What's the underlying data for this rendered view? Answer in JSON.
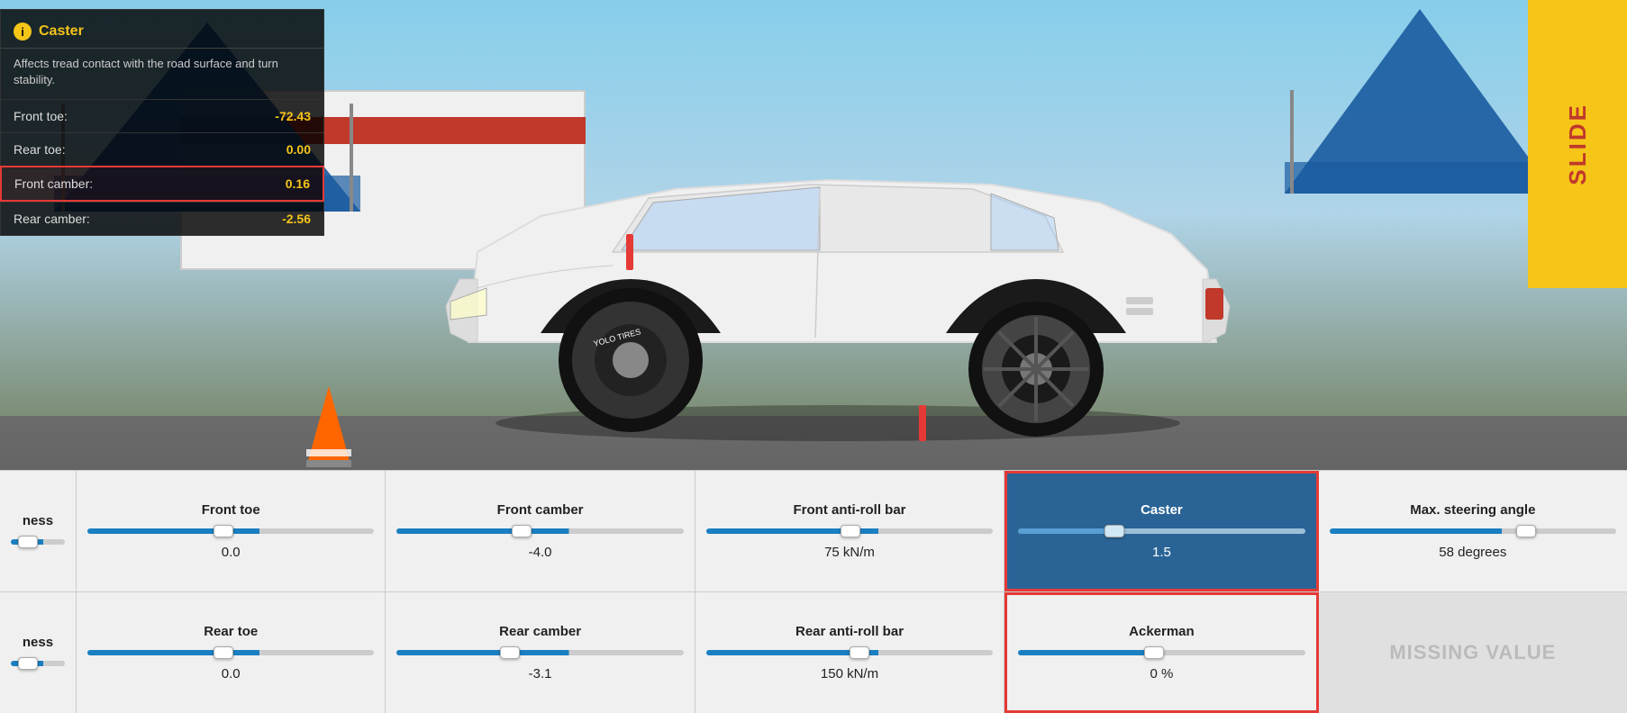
{
  "scene": {
    "bg_color_top": "#87CEEB",
    "bg_color_bottom": "#5a5a5a"
  },
  "info_panel": {
    "icon": "i",
    "title": "Caster",
    "description": "Affects tread contact with the road surface and turn stability.",
    "stats": [
      {
        "label": "Front toe:",
        "value": "-72.43",
        "highlighted": false
      },
      {
        "label": "Rear toe:",
        "value": "0.00",
        "highlighted": false
      },
      {
        "label": "Front camber:",
        "value": "0.16",
        "highlighted": true
      },
      {
        "label": "Rear camber:",
        "value": "-2.56",
        "highlighted": false
      }
    ]
  },
  "bottom_bar": {
    "row1": [
      {
        "id": "stiffness1",
        "label": "ness",
        "value": "",
        "has_slider": true,
        "slider_type": "normal",
        "thumb_pos": "20%",
        "partial": true,
        "active": false
      },
      {
        "id": "front-toe",
        "label": "Front toe",
        "value": "0.0",
        "has_slider": true,
        "slider_type": "normal",
        "thumb_pos": "50%",
        "active": false
      },
      {
        "id": "front-camber",
        "label": "Front camber",
        "value": "-4.0",
        "has_slider": true,
        "slider_type": "normal",
        "thumb_pos": "45%",
        "active": false
      },
      {
        "id": "front-anti-roll",
        "label": "Front anti-roll bar",
        "value": "75 kN/m",
        "has_slider": true,
        "slider_type": "normal",
        "thumb_pos": "52%",
        "active": false
      },
      {
        "id": "caster",
        "label": "Caster",
        "value": "1.5",
        "has_slider": true,
        "slider_type": "caster",
        "thumb_pos": "33%",
        "active": true
      },
      {
        "id": "max-steering",
        "label": "Max. steering angle",
        "value": "58 degrees",
        "has_slider": true,
        "slider_type": "normal",
        "thumb_pos": "70%",
        "active": false
      }
    ],
    "row2": [
      {
        "id": "stiffness2",
        "label": "ness",
        "value": "",
        "has_slider": true,
        "slider_type": "normal",
        "thumb_pos": "20%",
        "partial": true,
        "active": false
      },
      {
        "id": "rear-toe",
        "label": "Rear toe",
        "value": "0.0",
        "has_slider": true,
        "slider_type": "normal",
        "thumb_pos": "50%",
        "active": false
      },
      {
        "id": "rear-camber",
        "label": "Rear camber",
        "value": "-3.1",
        "has_slider": true,
        "slider_type": "normal",
        "thumb_pos": "40%",
        "active": false
      },
      {
        "id": "rear-anti-roll",
        "label": "Rear anti-roll bar",
        "value": "150 kN/m",
        "has_slider": true,
        "slider_type": "normal",
        "thumb_pos": "55%",
        "active": false
      },
      {
        "id": "ackerman",
        "label": "Ackerman",
        "value": "0 %",
        "has_slider": true,
        "slider_type": "ackerman",
        "thumb_pos": "50%",
        "active": false,
        "ackerman": true
      },
      {
        "id": "missing-value",
        "label": "MISSING VALUE",
        "value": "",
        "has_slider": false,
        "active": false,
        "missing": true
      }
    ]
  }
}
